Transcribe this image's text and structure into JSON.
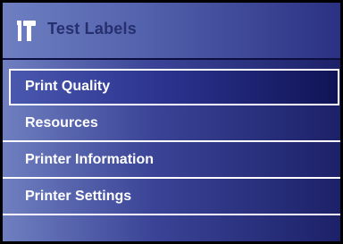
{
  "header": {
    "icon": "hammer-icon",
    "title": "Test Labels"
  },
  "menu": {
    "items": [
      {
        "label": "Print Quality",
        "selected": true
      },
      {
        "label": "Resources",
        "selected": false
      },
      {
        "label": "Printer Information",
        "selected": false
      },
      {
        "label": "Printer Settings",
        "selected": false
      }
    ]
  },
  "colors": {
    "header_title": "#27306e",
    "menu_text": "#ffffff",
    "frame": "#000000"
  }
}
